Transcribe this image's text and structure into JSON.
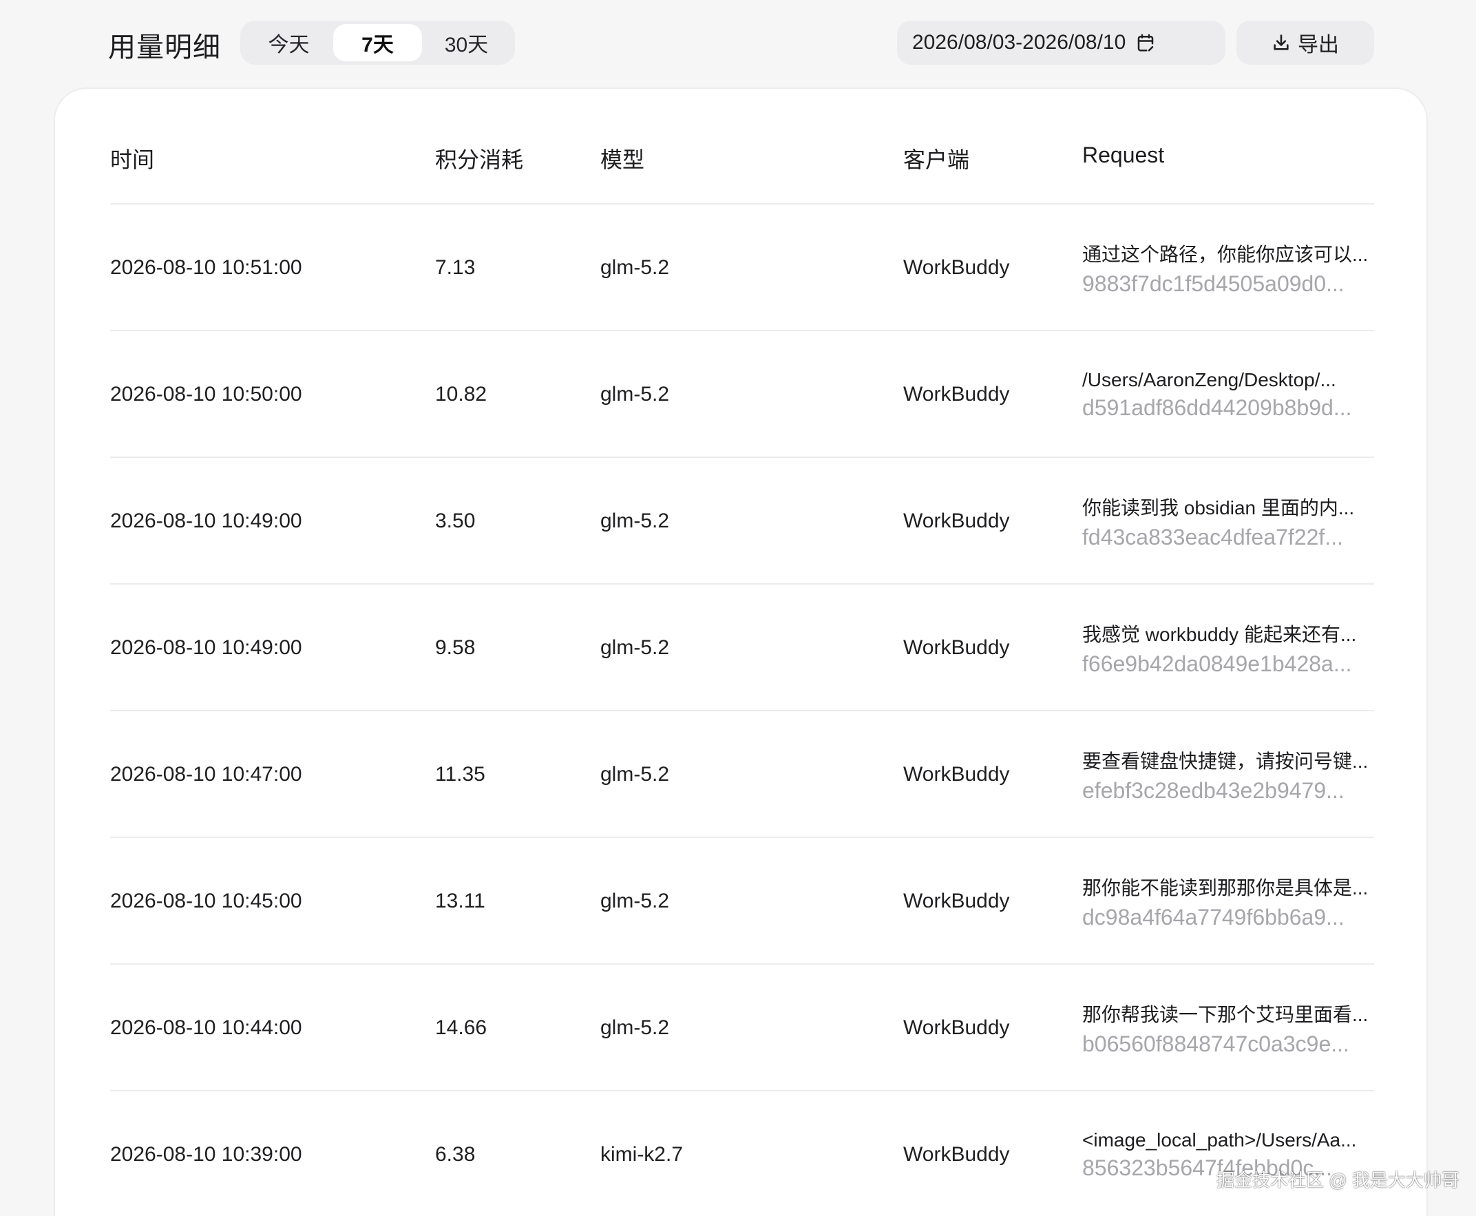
{
  "header": {
    "title": "用量明细",
    "range_tabs": [
      {
        "label": "今天",
        "active": false
      },
      {
        "label": "7天",
        "active": true
      },
      {
        "label": "30天",
        "active": false
      }
    ],
    "date_range": "2026/08/03-2026/08/10",
    "export_label": "导出",
    "icons": {
      "calendar": "calendar-icon",
      "export": "download-icon"
    }
  },
  "table": {
    "columns": [
      "时间",
      "积分消耗",
      "模型",
      "客户端",
      "Request"
    ],
    "rows": [
      {
        "time": "2026-08-10 10:51:00",
        "credits": "7.13",
        "model": "glm-5.2",
        "client": "WorkBuddy",
        "request_text": "通过这个路径，你能你应该可以...",
        "request_id": "9883f7dc1f5d4505a09d0..."
      },
      {
        "time": "2026-08-10 10:50:00",
        "credits": "10.82",
        "model": "glm-5.2",
        "client": "WorkBuddy",
        "request_text": "/Users/AaronZeng/Desktop/...",
        "request_id": "d591adf86dd44209b8b9d..."
      },
      {
        "time": "2026-08-10 10:49:00",
        "credits": "3.50",
        "model": "glm-5.2",
        "client": "WorkBuddy",
        "request_text": "你能读到我 obsidian 里面的内...",
        "request_id": "fd43ca833eac4dfea7f22f..."
      },
      {
        "time": "2026-08-10 10:49:00",
        "credits": "9.58",
        "model": "glm-5.2",
        "client": "WorkBuddy",
        "request_text": "我感觉 workbuddy 能起来还有...",
        "request_id": "f66e9b42da0849e1b428a..."
      },
      {
        "time": "2026-08-10 10:47:00",
        "credits": "11.35",
        "model": "glm-5.2",
        "client": "WorkBuddy",
        "request_text": "要查看键盘快捷键，请按问号键...",
        "request_id": "efebf3c28edb43e2b9479..."
      },
      {
        "time": "2026-08-10 10:45:00",
        "credits": "13.11",
        "model": "glm-5.2",
        "client": "WorkBuddy",
        "request_text": "那你能不能读到那那你是具体是...",
        "request_id": "dc98a4f64a7749f6bb6a9..."
      },
      {
        "time": "2026-08-10 10:44:00",
        "credits": "14.66",
        "model": "glm-5.2",
        "client": "WorkBuddy",
        "request_text": "那你帮我读一下那个艾玛里面看...",
        "request_id": "b06560f8848747c0a3c9e..."
      },
      {
        "time": "2026-08-10 10:39:00",
        "credits": "6.38",
        "model": "kimi-k2.7",
        "client": "WorkBuddy",
        "request_text": "<image_local_path>/Users/Aa...",
        "request_id": "856323b5647f4febbd0c..."
      }
    ]
  },
  "watermark": "掘金技术社区 @ 我是大大帅哥"
}
